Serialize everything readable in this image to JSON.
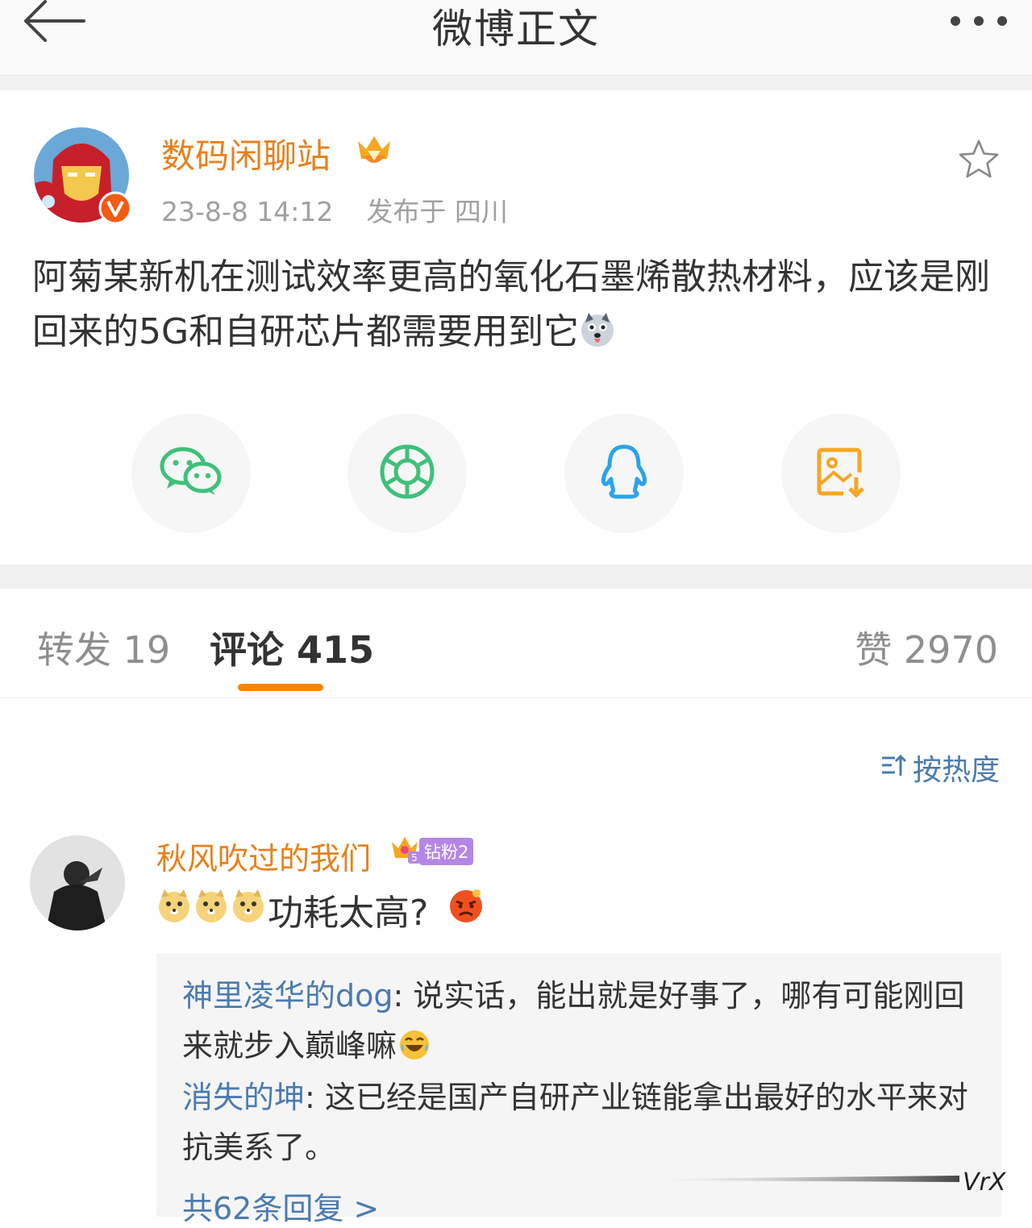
{
  "header": {
    "title": "微博正文",
    "back_icon": "arrow-left-icon",
    "more_icon": "more-dots-icon"
  },
  "post": {
    "author": "数码闲聊站",
    "timestamp": "23-8-8 14:12",
    "location_label": "发布于 四川",
    "text": "阿菊某新机在测试效率更高的氧化石墨烯散热材料，应该是刚回来的5G和自研芯片都需要用到它",
    "share_targets": [
      {
        "name": "wechat",
        "color": "#3fc07a"
      },
      {
        "name": "moments",
        "color": "#3fc07a"
      },
      {
        "name": "qq",
        "color": "#2ba3ea"
      },
      {
        "name": "save-image",
        "color": "#f5a623"
      }
    ]
  },
  "tabs": {
    "repost": "转发 19",
    "comments": "评论 415",
    "likes": "赞 2970"
  },
  "sort": {
    "label": "按热度"
  },
  "comment": {
    "author": "秋风吹过的我们",
    "fan_badge": "钻粉2",
    "fan_level": "5",
    "text": "功耗太高?",
    "replies": [
      {
        "name": "神里凌华的dog",
        "text": ": 说实话，能出就是好事了，哪有可能刚回来就步入巅峰嘛"
      },
      {
        "name": "消失的坤",
        "text": ": 这已经是国产自研产业链能拿出最好的水平来对抗美系了。"
      }
    ],
    "more_replies": "共62条回复 >"
  },
  "watermark": "VrX",
  "colors": {
    "accent_orange": "#ff8200",
    "name_orange": "#e8801d",
    "link_blue": "#4a7bb0",
    "fan_purple": "#b487e6"
  }
}
